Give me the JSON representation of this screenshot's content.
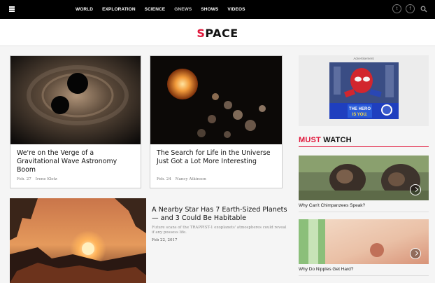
{
  "nav": {
    "items": [
      "WORLD",
      "EXPLORATION",
      "SCIENCE",
      "GNEWS",
      "SHOWS",
      "VIDEOS"
    ]
  },
  "social": {
    "twitter_glyph": "t",
    "facebook_glyph": "f"
  },
  "header": {
    "logo_first": "S",
    "logo_rest": "PACE"
  },
  "articles": [
    {
      "title": "We're on the Verge of a Gravitational Wave Astronomy Boom",
      "date": "Feb. 27",
      "author": "Irene Klotz"
    },
    {
      "title": "The Search for Life in the Universe Just Got a Lot More Interesting",
      "date": "Feb. 24",
      "author": "Nancy Atkinson"
    }
  ],
  "feature": {
    "title": "A Nearby Star Has 7 Earth-Sized Planets — and 3 Could Be Habitable",
    "desc": "Future scans of the TRAPPIST-1 exoplanets' atmospheres could reveal if any possess life.",
    "date": "Feb 22, 2017"
  },
  "ad": {
    "label": "Advertisement",
    "tagline_1": "THE HERO",
    "tagline_2": "IS YOU."
  },
  "must_watch": {
    "red": "MUST",
    "black": "WATCH",
    "videos": [
      {
        "title": "Why Can't Chimpanzees Speak?"
      },
      {
        "title": "Why Do Nipples Get Hard?"
      }
    ]
  },
  "colors": {
    "accent": "#e0173b",
    "topbar": "#000000"
  }
}
